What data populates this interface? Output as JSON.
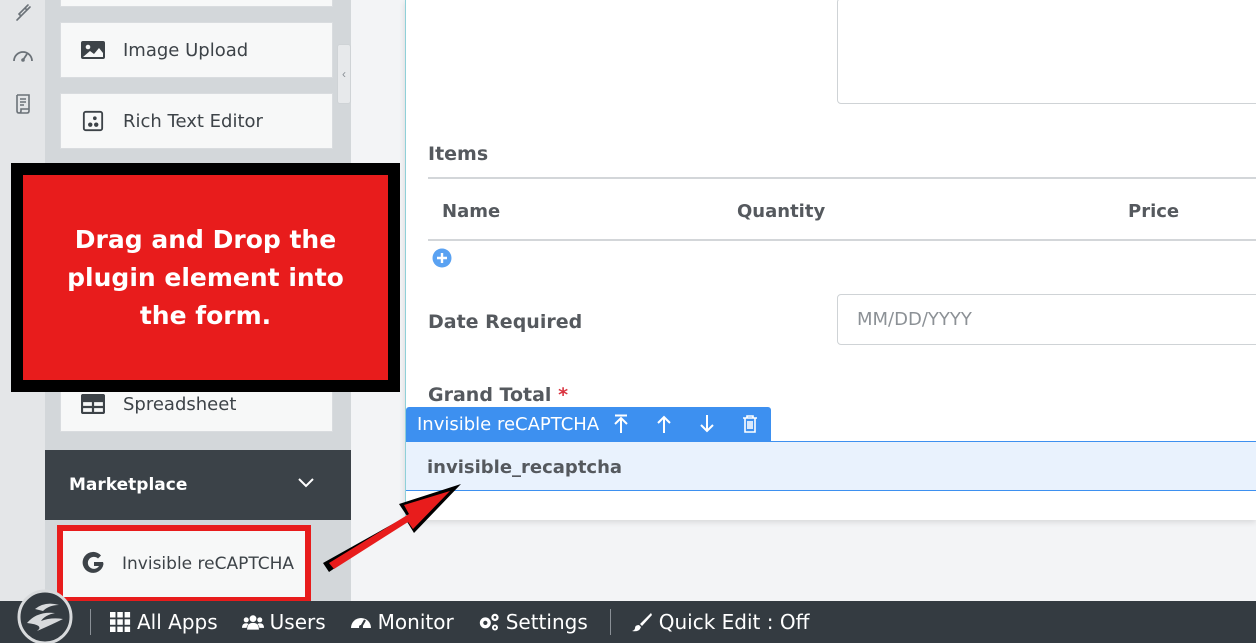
{
  "palette": {
    "accent": "#3d90f0",
    "callout": "#e81c1c",
    "sidebar": "#d3d7da",
    "dark": "#343b41"
  },
  "rail": {
    "icons": [
      "plug-icon",
      "gauge-icon",
      "script-icon"
    ]
  },
  "panel": {
    "tiles": [
      {
        "label": "",
        "icon": "blank-icon"
      },
      {
        "label": "Image Upload",
        "icon": "image-icon"
      },
      {
        "label": "Rich Text Editor",
        "icon": "rich-text-icon"
      },
      {
        "label": "Spreadsheet",
        "icon": "table-icon"
      }
    ],
    "marketplace": {
      "label": "Marketplace",
      "icon": "chevron-down-icon"
    },
    "plugin": {
      "label": "Invisible reCAPTCHA",
      "icon": "google-g-icon"
    }
  },
  "callout": {
    "text": "Drag and Drop the plugin element into the form."
  },
  "form": {
    "items_label": "Items",
    "columns": [
      "Name",
      "Quantity",
      "Price"
    ],
    "date_label": "Date Required",
    "date_placeholder": "MM/DD/YYYY",
    "grand_total_label": "Grand Total",
    "required_mark": "*",
    "element": {
      "toolbar_title": "Invisible reCAPTCHA",
      "name": "invisible_recaptcha",
      "actions": [
        "move-top-icon",
        "move-up-icon",
        "move-down-icon",
        "delete-icon"
      ]
    }
  },
  "bottombar": {
    "items": [
      {
        "label": "All Apps",
        "icon": "grid-icon"
      },
      {
        "label": "Users",
        "icon": "users-icon"
      },
      {
        "label": "Monitor",
        "icon": "gauge-icon"
      },
      {
        "label": "Settings",
        "icon": "gears-icon"
      },
      {
        "label": "Quick Edit : Off",
        "icon": "brush-icon"
      }
    ]
  }
}
